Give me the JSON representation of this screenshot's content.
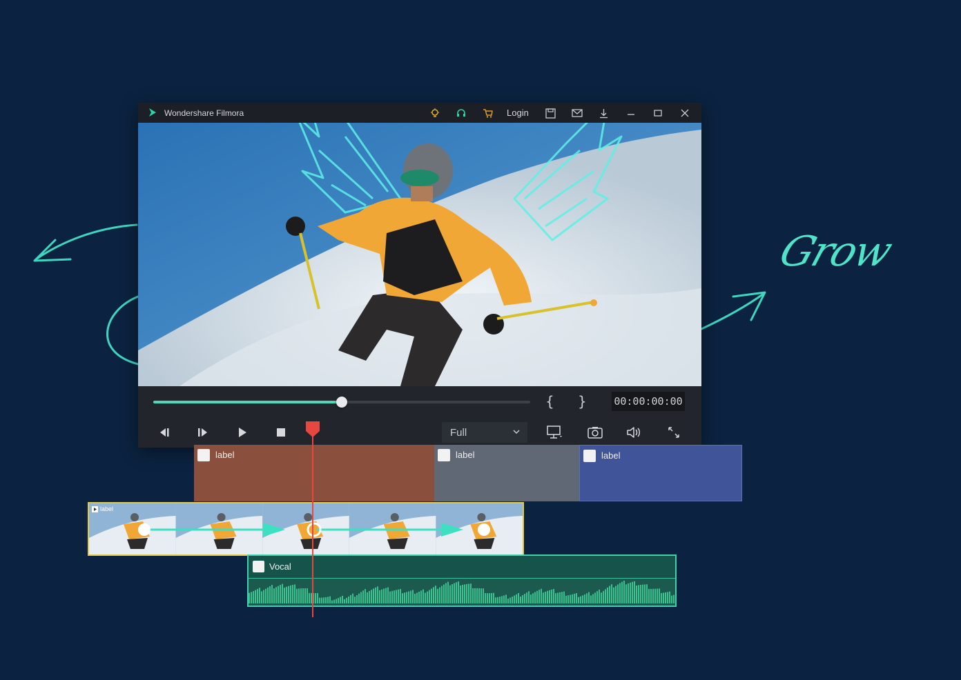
{
  "window": {
    "title": "Wondershare Filmora",
    "login_label": "Login"
  },
  "titlebar_icons": [
    "idea-bulb-icon",
    "headset-support-icon",
    "cart-icon",
    "save-icon",
    "mail-icon",
    "download-icon",
    "minimize-icon",
    "maximize-icon",
    "close-icon"
  ],
  "player": {
    "progress_percent": 50,
    "mark_in": "{",
    "mark_out": "}",
    "timecode": "00:00:00:00",
    "quality": {
      "selected": "Full"
    }
  },
  "timeline": {
    "title_clips": [
      {
        "label": "label",
        "color": "#8a4f3d"
      },
      {
        "label": "label",
        "color": "#5f6874"
      },
      {
        "label": "label",
        "color": "#3f5499"
      }
    ],
    "video_clip": {
      "label": "label",
      "border_color": "#e4c84a"
    },
    "audio_clip": {
      "label": "Vocal",
      "border_color": "#44d0ae"
    },
    "playhead_color": "#e8473f"
  },
  "decor": {
    "script_text": "Grow",
    "accent": "#4fe3c8"
  },
  "colors": {
    "background": "#0b2340",
    "accent": "#4ed8b8"
  }
}
